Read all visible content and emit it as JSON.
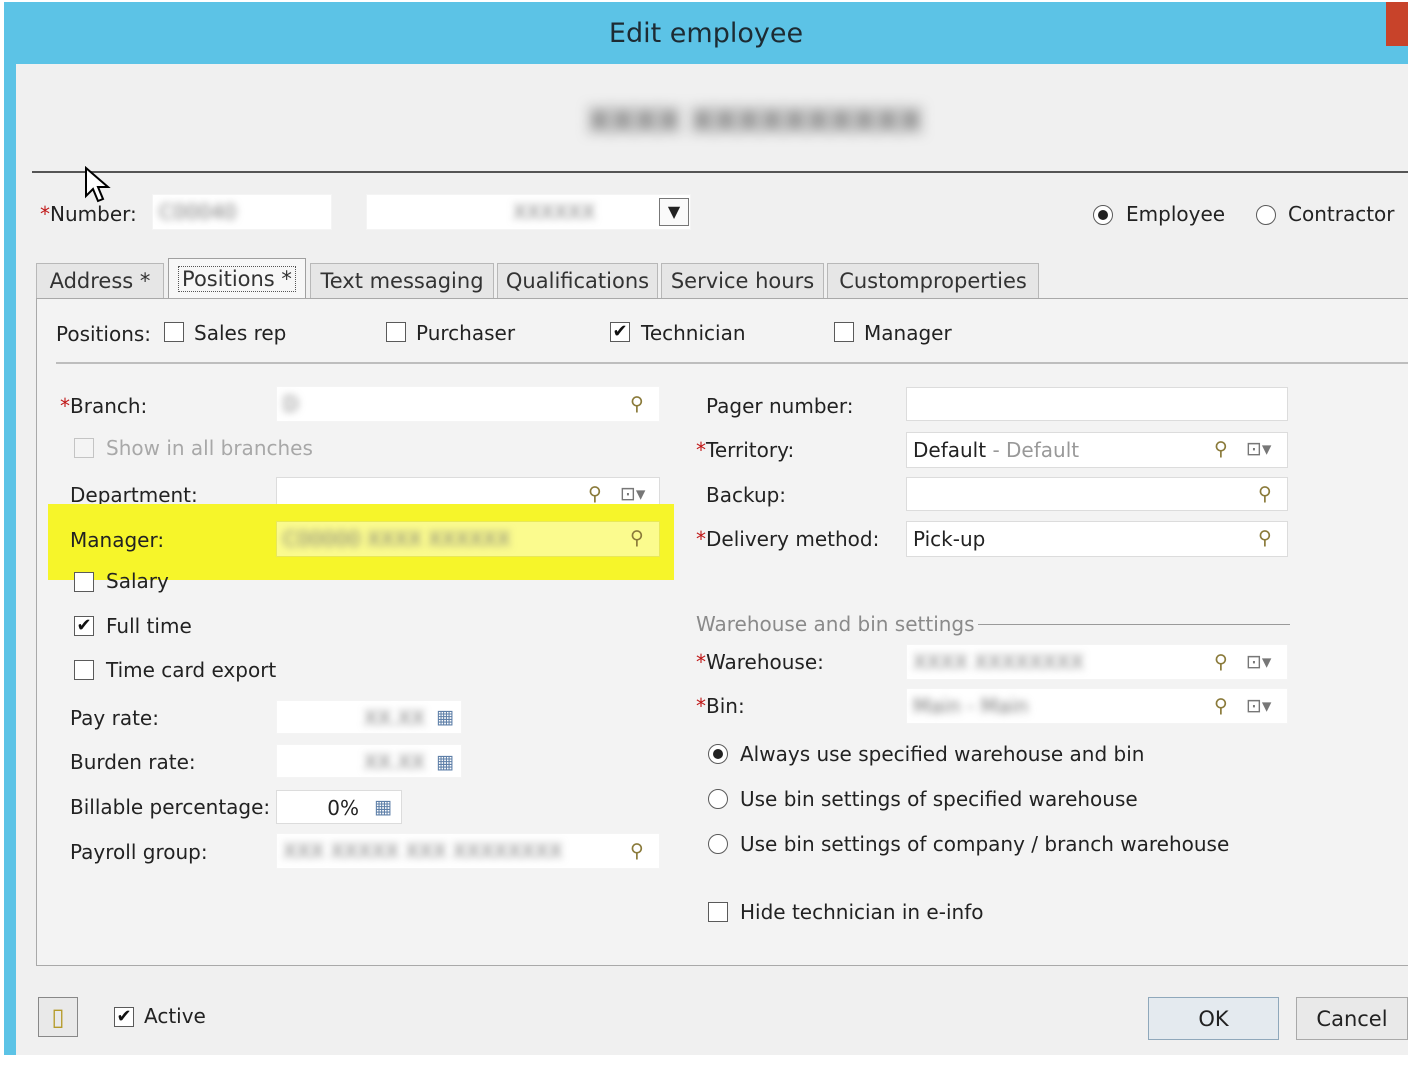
{
  "window": {
    "title": "Edit employee"
  },
  "header": {
    "employee_name": "XXXX XXXXXXXXXX"
  },
  "top": {
    "number_label": "Number:",
    "number_value": "C00040",
    "second_value": "XXXXXX",
    "type_options": [
      {
        "label": "Employee",
        "selected": true
      },
      {
        "label": "Contractor",
        "selected": false
      }
    ]
  },
  "tabs": [
    {
      "label": "Address *",
      "active": false
    },
    {
      "label": "Positions *",
      "active": true
    },
    {
      "label": "Text messaging",
      "active": false
    },
    {
      "label": "Qualifications",
      "active": false
    },
    {
      "label": "Service hours",
      "active": false
    },
    {
      "label": "Customproperties",
      "active": false
    }
  ],
  "positions": {
    "label": "Positions:",
    "items": [
      {
        "label": "Sales rep",
        "checked": false
      },
      {
        "label": "Purchaser",
        "checked": false
      },
      {
        "label": "Technician",
        "checked": true
      },
      {
        "label": "Manager",
        "checked": false
      }
    ]
  },
  "left": {
    "branch_label": "Branch:",
    "branch_value": "D",
    "show_all_branches_label": "Show in all branches",
    "department_label": "Department:",
    "department_value": "",
    "manager_label": "Manager:",
    "manager_value": "C00000 XXXX XXXXXX",
    "salary_label": "Salary",
    "full_time_label": "Full time",
    "time_card_label": "Time card export",
    "pay_rate_label": "Pay rate:",
    "pay_rate_value": "XX.XX",
    "burden_rate_label": "Burden rate:",
    "burden_rate_value": "XX.XX",
    "billable_label": "Billable percentage:",
    "billable_value": "0%",
    "payroll_label": "Payroll group:",
    "payroll_value": "XXX XXXXX XXX XXXXXXXX"
  },
  "right": {
    "pager_label": "Pager number:",
    "pager_value": "",
    "territory_label": "Territory:",
    "territory_value": "Default",
    "territory_desc": "- Default",
    "backup_label": "Backup:",
    "backup_value": "",
    "delivery_label": "Delivery method:",
    "delivery_value": "Pick-up",
    "warehouse_section": "Warehouse and bin settings",
    "warehouse_label": "Warehouse:",
    "warehouse_value": "XXXX XXXXXXXX",
    "bin_label": "Bin:",
    "bin_value": "Main - Main",
    "bin_options": [
      {
        "label": "Always use specified warehouse and bin",
        "selected": true
      },
      {
        "label": "Use bin settings of specified warehouse",
        "selected": false
      },
      {
        "label": "Use bin settings of company / branch warehouse",
        "selected": false
      }
    ],
    "hide_technician_label": "Hide technician in e-info"
  },
  "footer": {
    "active_label": "Active",
    "ok_label": "OK",
    "cancel_label": "Cancel"
  },
  "colors": {
    "titlebar": "#5cc3e6",
    "highlight": "#f6f52a",
    "required": "#c01818"
  }
}
